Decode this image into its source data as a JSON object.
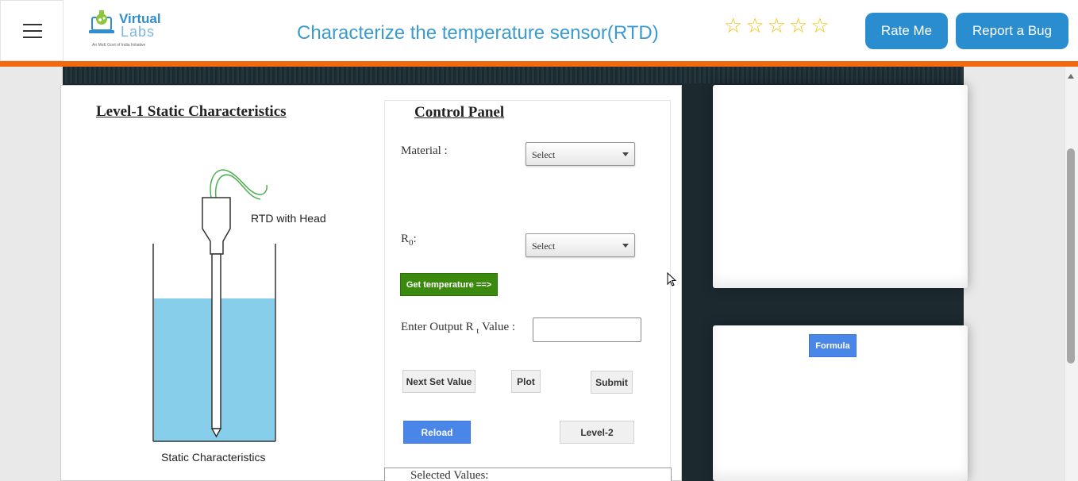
{
  "header": {
    "menu_icon": "hamburger-icon",
    "logo": {
      "word1": "Virtual",
      "word2": "Labs",
      "tagline": "An MoE Govt of India Initiative"
    },
    "title": "Characterize the temperature sensor(RTD)",
    "rating_icon": "star-outline-icon",
    "rating_count": 5,
    "rate_button": "Rate Me",
    "bug_button": "Report a Bug"
  },
  "colors": {
    "accent_orange": "#f26a0d",
    "header_button": "#2a8dd0",
    "title_blue": "#3a9bd1",
    "dark_background": "#1c2a30",
    "water": "#87ceeb",
    "get_temperature_green": "#3b8a0f",
    "reload_blue": "#4a86e8"
  },
  "experiment": {
    "level_title": "Level-1 Static Characteristics",
    "rtd_label": "RTD with Head",
    "caption": "Static Characteristics"
  },
  "control_panel": {
    "title": "Control Panel",
    "material_label": "Material :",
    "material_value": "Select",
    "r0_label": "R",
    "r0_sub": "0",
    "r0_suffix": ":",
    "r0_value": "Select",
    "get_temperature": "Get temperature ==>",
    "output_label_prefix": "Enter Output R",
    "output_label_sub": "t",
    "output_label_suffix": " Value :",
    "output_value": "",
    "next_set_value": "Next Set Value",
    "plot": "Plot",
    "submit": "Submit",
    "reload": "Reload",
    "level2": "Level-2",
    "selected_values": "Selected Values:"
  },
  "right_panel": {
    "formula_button": "Formula"
  }
}
